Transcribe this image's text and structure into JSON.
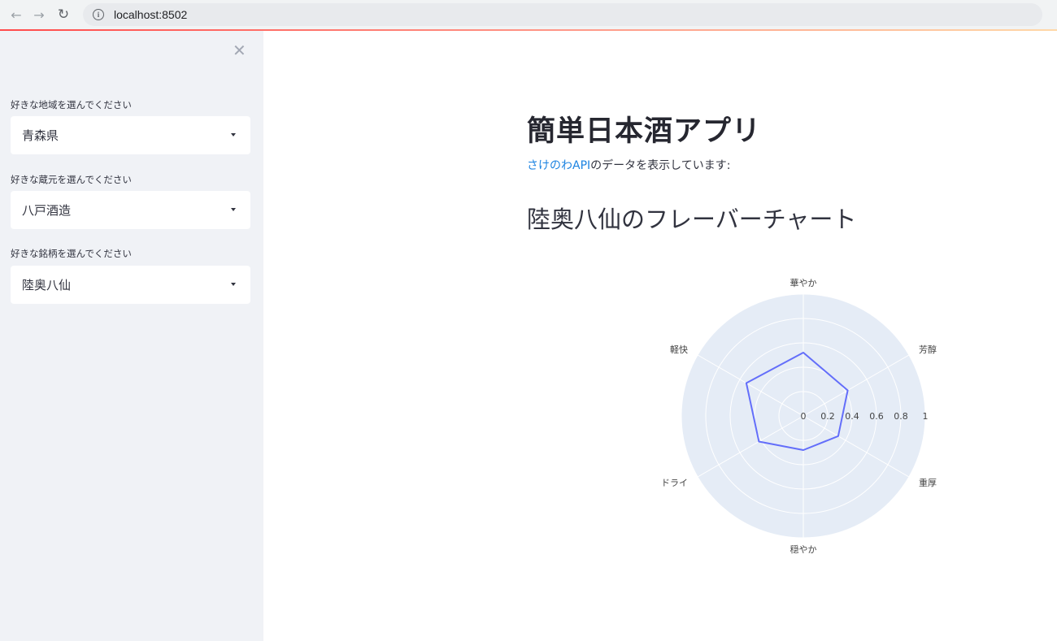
{
  "browser": {
    "url": "localhost:8502"
  },
  "sidebar": {
    "selects": [
      {
        "label": "好きな地域を選んでください",
        "value": "青森県"
      },
      {
        "label": "好きな蔵元を選んでください",
        "value": "八戸酒造"
      },
      {
        "label": "好きな銘柄を選んでください",
        "value": "陸奥八仙"
      }
    ]
  },
  "main": {
    "title": "簡単日本酒アプリ",
    "subtitle_link": "さけのわAPI",
    "subtitle_rest": "のデータを表示しています:",
    "chart_heading": "陸奥八仙のフレーバーチャート"
  },
  "colors": {
    "accent_line": "#ff4b4b",
    "trace": "#636efa",
    "polar_bg": "#e5ecf6",
    "link": "#1c83e1"
  },
  "chart_data": {
    "type": "radar",
    "categories": [
      "華やか",
      "芳醇",
      "重厚",
      "穏やか",
      "ドライ",
      "軽快"
    ],
    "values": [
      0.52,
      0.42,
      0.33,
      0.28,
      0.42,
      0.54
    ],
    "radial_ticks": [
      "0",
      "0.2",
      "0.4",
      "0.6",
      "0.8",
      "1"
    ],
    "radial_range": [
      0,
      1
    ],
    "grid": true
  }
}
